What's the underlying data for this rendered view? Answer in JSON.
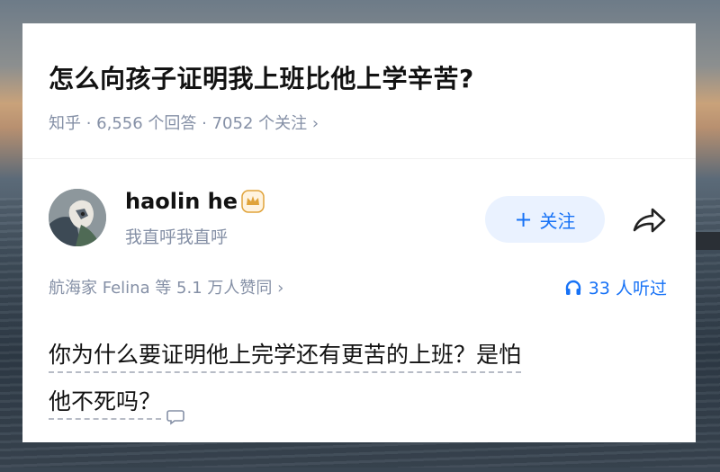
{
  "question": {
    "title": "怎么向孩子证明我上班比他上学辛苦?",
    "source": "知乎",
    "answers": "6,556 个回答",
    "followers": "7052 个关注",
    "separator": " · ",
    "chevron": "›"
  },
  "author": {
    "name": "haolin he",
    "bio": "我直呼我直呼",
    "badge_icon": "crown-badge-icon",
    "follow_label": "关注",
    "follow_plus": "+"
  },
  "stats": {
    "votes": "航海家 Felina 等 5.1 万人赞同",
    "votes_chevron": "›",
    "listened": "33 人听过"
  },
  "answer": {
    "line1": "你为什么要证明他上完学还有更苦的上班？是怕",
    "line2": "他不死吗？"
  },
  "colors": {
    "accent": "#1772f6",
    "follow_bg": "#eaf2ff",
    "meta": "#8590a6",
    "badge": "#e0a33a"
  }
}
